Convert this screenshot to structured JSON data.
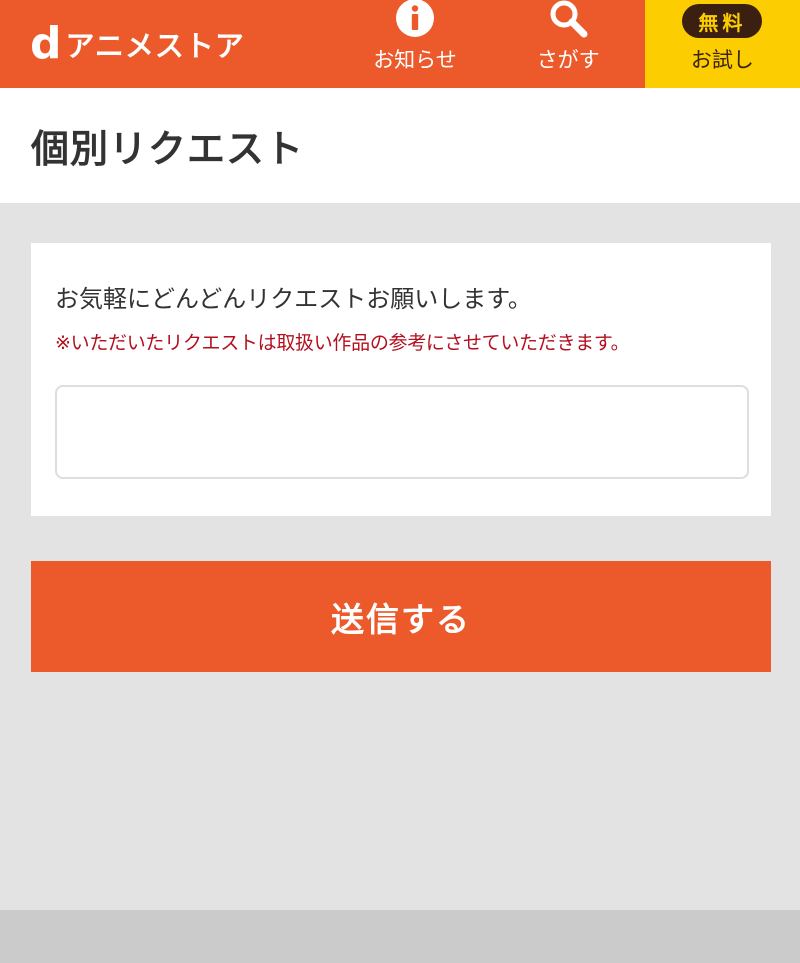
{
  "header": {
    "logo_mark": "d",
    "logo_text": "アニメストア",
    "nav": [
      {
        "label": "お知らせ",
        "icon": "info-icon"
      },
      {
        "label": "さがす",
        "icon": "search-icon"
      }
    ],
    "trial": {
      "badge": "無料",
      "label": "お試し"
    }
  },
  "page": {
    "title": "個別リクエスト"
  },
  "form": {
    "lead": "お気軽にどんどんリクエストお願いします。",
    "note": "※いただいたリクエストは取扱い作品の参考にさせていただきます。",
    "input_value": "",
    "submit_label": "送信する"
  },
  "colors": {
    "brand": "#ec5a2b",
    "trial": "#fccd00",
    "note": "#b30f1e"
  }
}
